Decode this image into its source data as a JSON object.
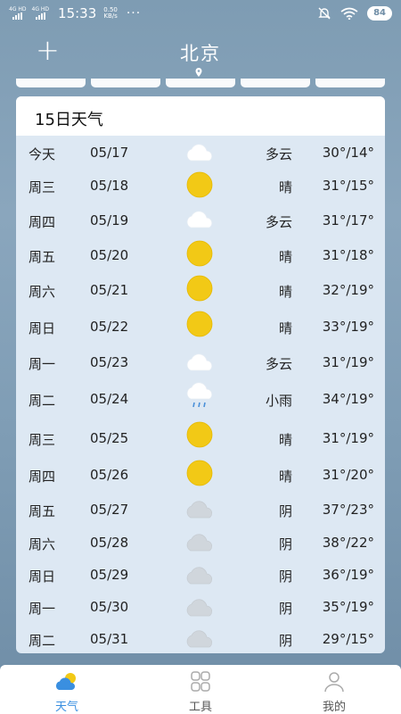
{
  "status_bar": {
    "sig1": "4G HD",
    "sig2": "4G HD",
    "time": "15:33",
    "rate_value": "0.50",
    "rate_unit": "KB/s",
    "dots": "···",
    "battery": "84"
  },
  "header": {
    "add_label": "+",
    "city": "北京"
  },
  "forecast": {
    "title": "15日天气",
    "rows": [
      {
        "day": "今天",
        "date": "05/17",
        "icon": "cloudy-icon",
        "cond": "多云",
        "temp": "30°/14°"
      },
      {
        "day": "周三",
        "date": "05/18",
        "icon": "sunny-icon",
        "cond": "晴",
        "temp": "31°/15°"
      },
      {
        "day": "周四",
        "date": "05/19",
        "icon": "cloudy-icon",
        "cond": "多云",
        "temp": "31°/17°"
      },
      {
        "day": "周五",
        "date": "05/20",
        "icon": "sunny-icon",
        "cond": "晴",
        "temp": "31°/18°"
      },
      {
        "day": "周六",
        "date": "05/21",
        "icon": "sunny-icon",
        "cond": "晴",
        "temp": "32°/19°"
      },
      {
        "day": "周日",
        "date": "05/22",
        "icon": "sunny-icon",
        "cond": "晴",
        "temp": "33°/19°"
      },
      {
        "day": "周一",
        "date": "05/23",
        "icon": "cloudy-icon",
        "cond": "多云",
        "temp": "31°/19°"
      },
      {
        "day": "周二",
        "date": "05/24",
        "icon": "light-rain-icon",
        "cond": "小雨",
        "temp": "34°/19°"
      },
      {
        "day": "周三",
        "date": "05/25",
        "icon": "sunny-icon",
        "cond": "晴",
        "temp": "31°/19°"
      },
      {
        "day": "周四",
        "date": "05/26",
        "icon": "sunny-icon",
        "cond": "晴",
        "temp": "31°/20°"
      },
      {
        "day": "周五",
        "date": "05/27",
        "icon": "overcast-icon",
        "cond": "阴",
        "temp": "37°/23°"
      },
      {
        "day": "周六",
        "date": "05/28",
        "icon": "overcast-icon",
        "cond": "阴",
        "temp": "38°/22°"
      },
      {
        "day": "周日",
        "date": "05/29",
        "icon": "overcast-icon",
        "cond": "阴",
        "temp": "36°/19°"
      },
      {
        "day": "周一",
        "date": "05/30",
        "icon": "overcast-icon",
        "cond": "阴",
        "temp": "35°/19°"
      },
      {
        "day": "周二",
        "date": "05/31",
        "icon": "overcast-icon",
        "cond": "阴",
        "temp": "29°/15°"
      }
    ]
  },
  "nav": {
    "weather": "天气",
    "tools": "工具",
    "mine": "我的"
  },
  "colors": {
    "accent": "#3a8fe0",
    "sun": "#f2c916",
    "card_bg": "#dde8f3"
  }
}
